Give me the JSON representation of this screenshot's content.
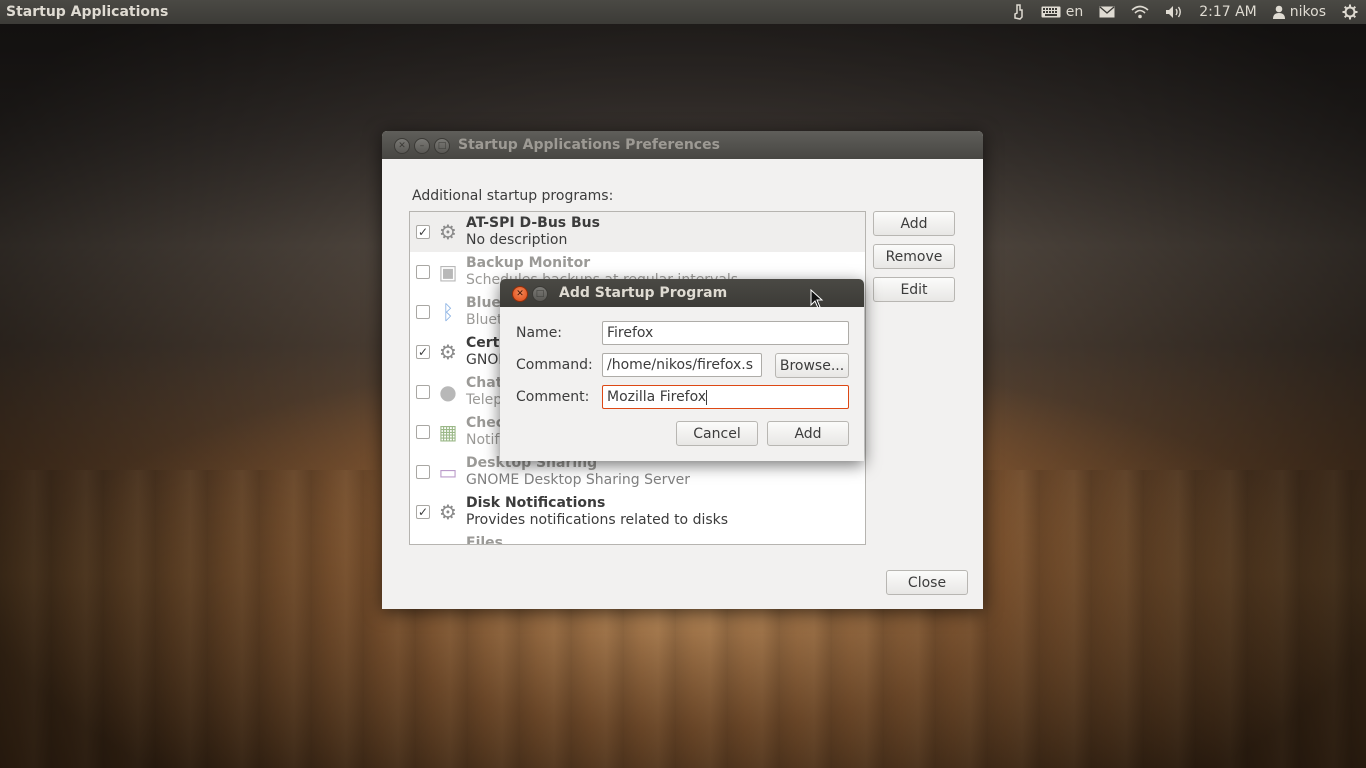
{
  "top_panel": {
    "app_title": "Startup Applications",
    "keyboard_layout": "en",
    "clock": "2:17 AM",
    "user": "nikos",
    "icons": [
      "accessibility-icon",
      "keyboard-icon",
      "mail-icon",
      "wifi-icon",
      "volume-icon",
      "user-icon",
      "power-gear-icon"
    ]
  },
  "main_window": {
    "title": "Startup Applications Preferences",
    "list_label": "Additional startup programs:",
    "programs": [
      {
        "name": "AT-SPI D-Bus Bus",
        "description": "No description",
        "checked": true,
        "icon": "gears-icon"
      },
      {
        "name": "Backup Monitor",
        "description": "Schedules backups at regular intervals",
        "checked": false,
        "icon": "backup-icon"
      },
      {
        "name": "Bluetooth",
        "description": "Bluetooth",
        "checked": false,
        "icon": "bluetooth-icon"
      },
      {
        "name": "Certificate",
        "description": "GNOME",
        "checked": true,
        "icon": "gears-icon"
      },
      {
        "name": "Chat",
        "description": "Telepathy",
        "checked": false,
        "icon": "chat-icon"
      },
      {
        "name": "Check",
        "description": "Notify",
        "checked": false,
        "icon": "update-check-icon"
      },
      {
        "name": "Desktop Sharing",
        "description": "GNOME Desktop Sharing Server",
        "checked": false,
        "icon": "desktop-sharing-icon"
      },
      {
        "name": "Disk Notifications",
        "description": "Provides notifications related to disks",
        "checked": true,
        "icon": "gears-icon"
      },
      {
        "name": "Files",
        "description": "",
        "checked": false,
        "icon": "files-icon"
      }
    ],
    "buttons": {
      "add": "Add",
      "remove": "Remove",
      "edit": "Edit",
      "close": "Close"
    }
  },
  "dialog": {
    "title": "Add Startup Program",
    "name_label": "Name:",
    "name_value": "Firefox",
    "command_label": "Command:",
    "command_value": "/home/nikos/firefox.s",
    "browse_label": "Browse...",
    "comment_label": "Comment:",
    "comment_value": "Mozilla Firefox",
    "cancel_label": "Cancel",
    "add_label": "Add"
  }
}
